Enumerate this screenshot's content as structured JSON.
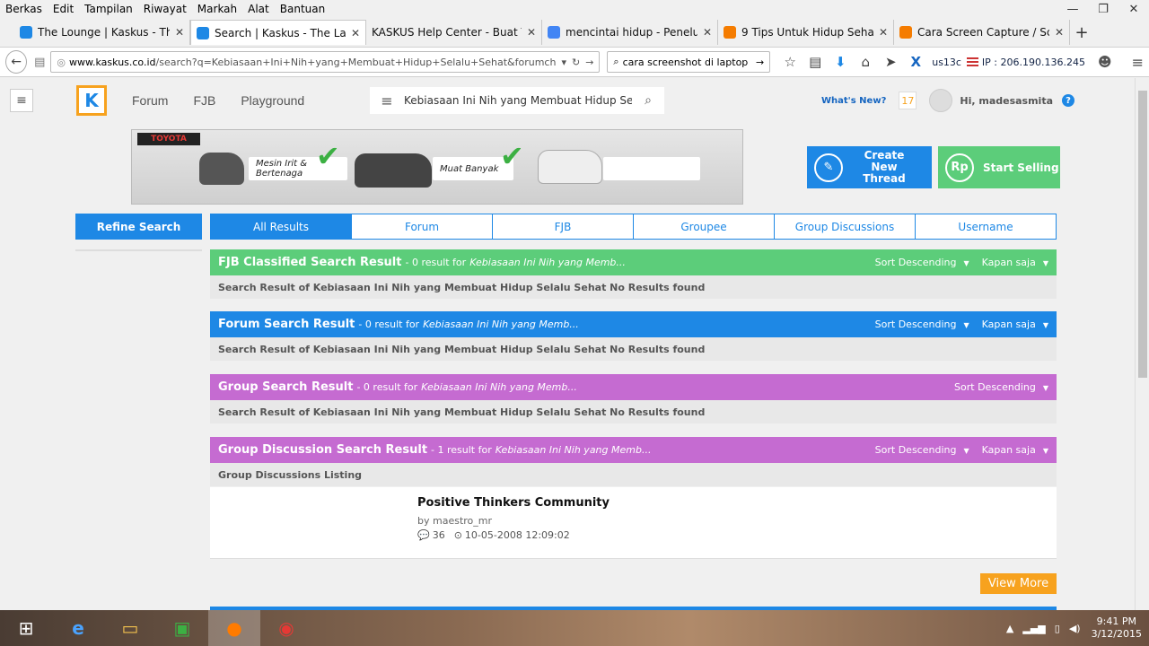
{
  "menubar": [
    "Berkas",
    "Edit",
    "Tampilan",
    "Riwayat",
    "Markah",
    "Alat",
    "Bantuan"
  ],
  "window_controls": [
    "—",
    "❐",
    "✕"
  ],
  "browser_tabs": [
    {
      "label": "The Lounge | Kaskus - The ...",
      "color": "#1e88e5",
      "active": false
    },
    {
      "label": "Search | Kaskus - The Large...",
      "color": "#1e88e5",
      "active": true
    },
    {
      "label": "KASKUS Help Center - Buat Thr...",
      "color": "#ffffff",
      "active": false
    },
    {
      "label": "mencintai hidup - Penelus...",
      "color": "#4285f4",
      "active": false
    },
    {
      "label": "9 Tips Untuk Hidup Sehat ...",
      "color": "#f57c00",
      "active": false
    },
    {
      "label": "Cara Screen Capture / Scre...",
      "color": "#f57c00",
      "active": false
    }
  ],
  "address": {
    "domain": "www.kaskus.co.id",
    "path": "/search?q=Kebiasaan+Ini+Nih+yang+Membuat+Hidup+Selalu+Sehat&forumchoice="
  },
  "browser_search": "cara screenshot di laptop",
  "ip_info": {
    "user": "us13c",
    "ip": "IP : 206.190.136.245"
  },
  "kaskus": {
    "logo": "K",
    "nav": [
      "Forum",
      "FJB",
      "Playground"
    ],
    "search_value": "Kebiasaan Ini Nih yang Membuat Hidup Sela",
    "whats_new": "What's New?",
    "notif_count": "17",
    "greeting": "Hi, madesasmita",
    "help": "?"
  },
  "banner": {
    "brand": "TOYOTA",
    "pill1": "Mesin Irit & Bertenaga",
    "pill2": "Muat Banyak"
  },
  "actions": {
    "create_thread": "Create New Thread",
    "start_selling": "Start Selling",
    "rp": "Rp"
  },
  "refine": "Refine Search",
  "result_tabs": [
    "All Results",
    "Forum",
    "FJB",
    "Groupee",
    "Group Discussions",
    "Username"
  ],
  "sections": [
    {
      "title": "FJB Classified Search Result",
      "count": "- 0 result for",
      "query": "Kebiasaan Ini Nih yang Memb...",
      "sort": "Sort Descending",
      "time": "Kapan saja",
      "body": "Search Result of Kebiasaan Ini Nih yang Membuat Hidup Selalu Sehat No Results found",
      "color": "#5ccd7a"
    },
    {
      "title": "Forum Search Result",
      "count": "- 0 result for",
      "query": "Kebiasaan Ini Nih yang Memb...",
      "sort": "Sort Descending",
      "time": "Kapan saja",
      "body": "Search Result of Kebiasaan Ini Nih yang Membuat Hidup Selalu Sehat No Results found",
      "color": "#1e88e5"
    },
    {
      "title": "Group Search Result",
      "count": "- 0 result for",
      "query": "Kebiasaan Ini Nih yang Memb...",
      "sort": "Sort Descending",
      "body": "Search Result of Kebiasaan Ini Nih yang Membuat Hidup Selalu Sehat No Results found",
      "color": "#c56bd1"
    },
    {
      "title": "Group Discussion Search Result",
      "count": "- 1 result for",
      "query": "Kebiasaan Ini Nih yang Memb...",
      "sort": "Sort Descending",
      "time": "Kapan saja",
      "body": "Group Discussions Listing",
      "color": "#c56bd1"
    }
  ],
  "group_discussion": {
    "name": "Positive Thinkers Community",
    "by": "by maestro_mr",
    "replies": "36",
    "date": "10-05-2008 12:09:02"
  },
  "view_more": "View More",
  "tray": {
    "time": "9:41 PM",
    "date": "3/12/2015"
  }
}
